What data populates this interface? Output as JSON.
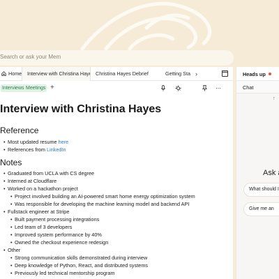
{
  "search": {
    "placeholder": "Search or ask your Mem"
  },
  "tabs": [
    {
      "label": "Home"
    },
    {
      "label": "Interview with Christina Hayes"
    },
    {
      "label": "Christina Hayes Debrief"
    },
    {
      "label": "Getting Sta"
    }
  ],
  "toolbar": {
    "tags": [
      "Interviews",
      "Meetings"
    ],
    "add_label": "+"
  },
  "doc": {
    "title": "Interview with Christina Hayes",
    "reference_heading": "Reference",
    "reference": [
      {
        "text": "Most updated resume ",
        "link": "here"
      },
      {
        "text": "References from ",
        "link": "LinkedIn"
      }
    ],
    "notes_heading": "Notes",
    "notes": [
      {
        "level": 1,
        "text": "Graduated from UCLA with CS degree"
      },
      {
        "level": 1,
        "text": "Interned at Cloudflare"
      },
      {
        "level": 1,
        "text": "Worked on a hackathon project"
      },
      {
        "level": 2,
        "text": "Project involved building an AI-powered smart home energy optimization system"
      },
      {
        "level": 2,
        "text": "Was responsible for developing the machine learning model and backend API"
      },
      {
        "level": 1,
        "text": "Fullstack engineer at Stripe"
      },
      {
        "level": 2,
        "text": "Built payment processing integrations"
      },
      {
        "level": 2,
        "text": "Led team of 3 developers"
      },
      {
        "level": 2,
        "text": "Improved system performance by 40%"
      },
      {
        "level": 2,
        "text": "Owned the checkout experience redesign"
      },
      {
        "level": 1,
        "text": "Other"
      },
      {
        "level": 2,
        "text": "Strong communication skills demonstrated during interview"
      },
      {
        "level": 2,
        "text": "Deep knowledge of Python, React, and distributed systems"
      },
      {
        "level": 2,
        "text": "Previously led technical mentorship program"
      }
    ]
  },
  "sidebar": {
    "title": "Heads up",
    "chat_label": "Chat",
    "ask_text": "Ask a",
    "suggestions": [
      "What should I",
      "Give me an"
    ]
  },
  "colors": {
    "accent_dot": "#e8553d",
    "link": "#2c7bd6",
    "tag_bg": "#dff3e4",
    "tag_text": "#2e7b46"
  }
}
